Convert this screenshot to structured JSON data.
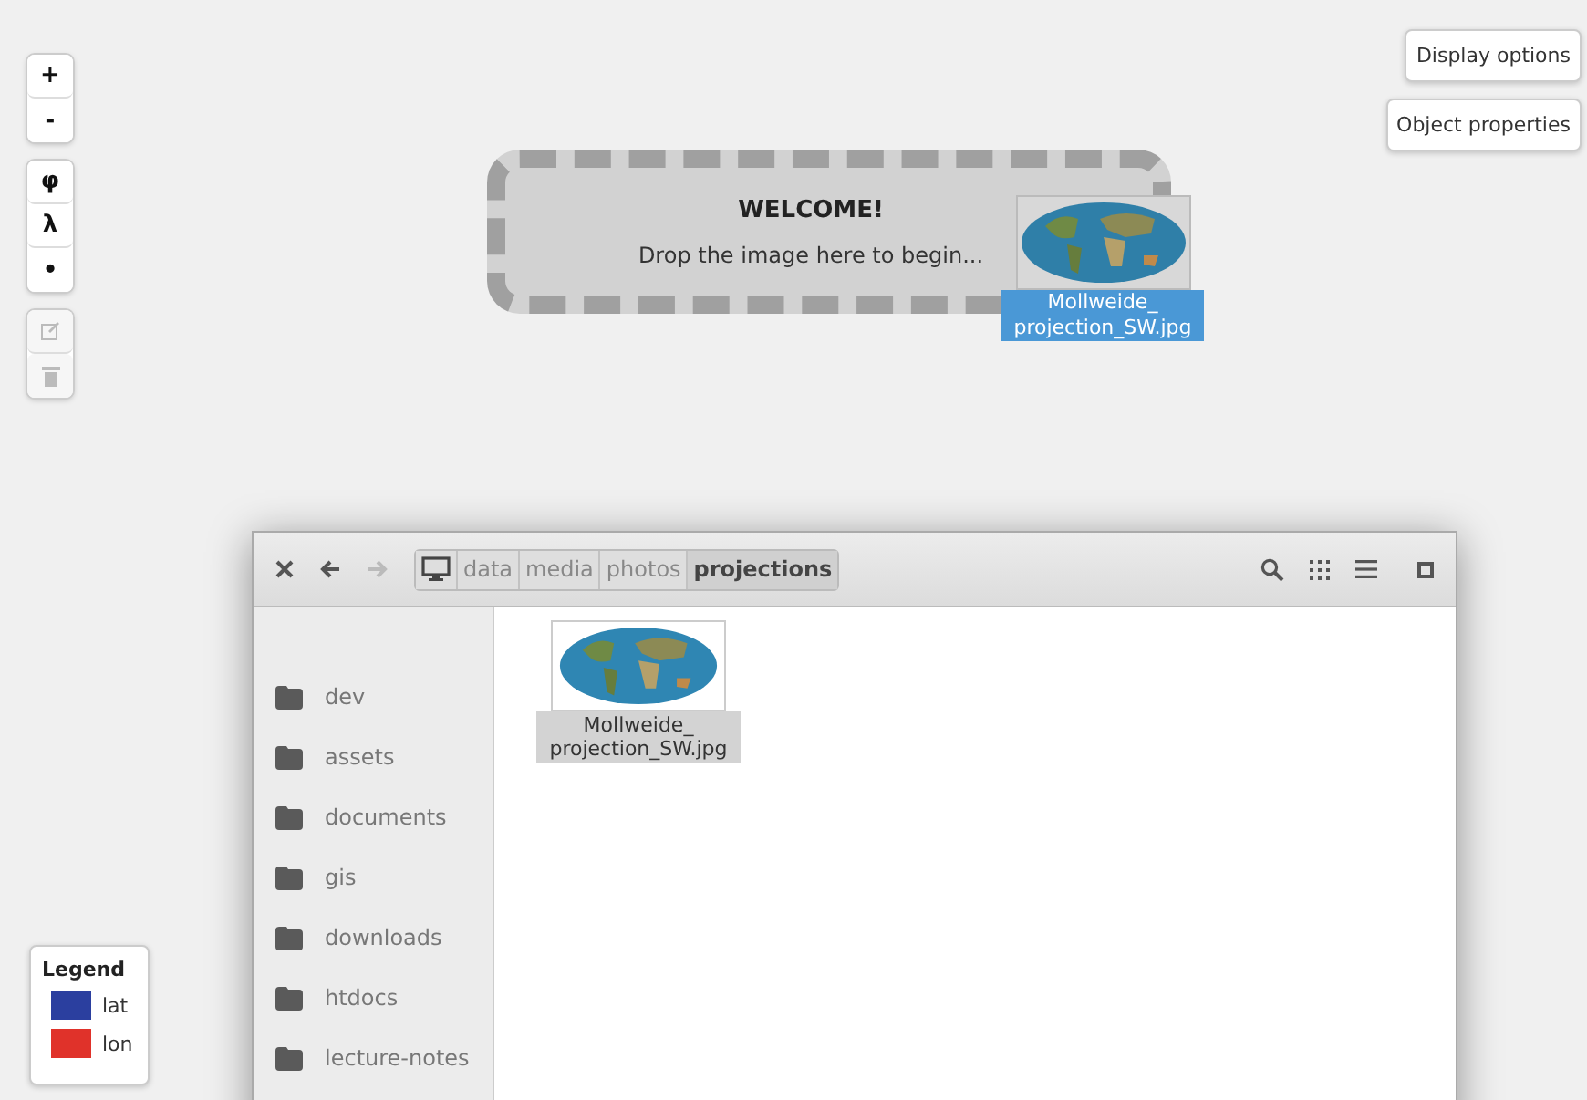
{
  "map_controls": {
    "groups": [
      [
        {
          "kind": "text",
          "label": "+",
          "disabled": false
        },
        {
          "kind": "text",
          "label": "-",
          "disabled": false
        }
      ],
      [
        {
          "kind": "text",
          "label": "φ",
          "disabled": false
        },
        {
          "kind": "text",
          "label": "λ",
          "disabled": false
        },
        {
          "kind": "text",
          "label": "•",
          "disabled": false
        }
      ],
      [
        {
          "kind": "edit",
          "disabled": true
        },
        {
          "kind": "delete",
          "disabled": true
        }
      ]
    ]
  },
  "panel_buttons": [
    "Display options",
    "Object properties"
  ],
  "drop_zone": {
    "title": "WELCOME!",
    "text": "Drop the image here to begin..."
  },
  "dragged_file": {
    "kind": "picture",
    "name_lines": [
      "Mollweide_",
      "projection_SW.jpg"
    ],
    "selected": true
  },
  "file_manager": {
    "navigation": {
      "back_disabled": false,
      "forward_disabled": true
    },
    "path": [
      {
        "label": "data",
        "selected": false
      },
      {
        "label": "media",
        "selected": false
      },
      {
        "label": "photos",
        "selected": false
      },
      {
        "label": "projections",
        "selected": true
      }
    ],
    "sidebar": [
      {
        "label": "dev"
      },
      {
        "label": "assets"
      },
      {
        "label": "documents"
      },
      {
        "label": "gis"
      },
      {
        "label": "downloads"
      },
      {
        "label": "htdocs"
      },
      {
        "label": "lecture-notes"
      }
    ],
    "files": [
      {
        "kind": "picture",
        "name_lines": [
          "Mollweide_",
          "projection_SW.jpg"
        ],
        "selected": true
      }
    ]
  },
  "legend": {
    "title": "Legend",
    "items": [
      {
        "label": "lat",
        "color": "#2b3f9f"
      },
      {
        "label": "lon",
        "color": "#e0322a"
      }
    ]
  }
}
